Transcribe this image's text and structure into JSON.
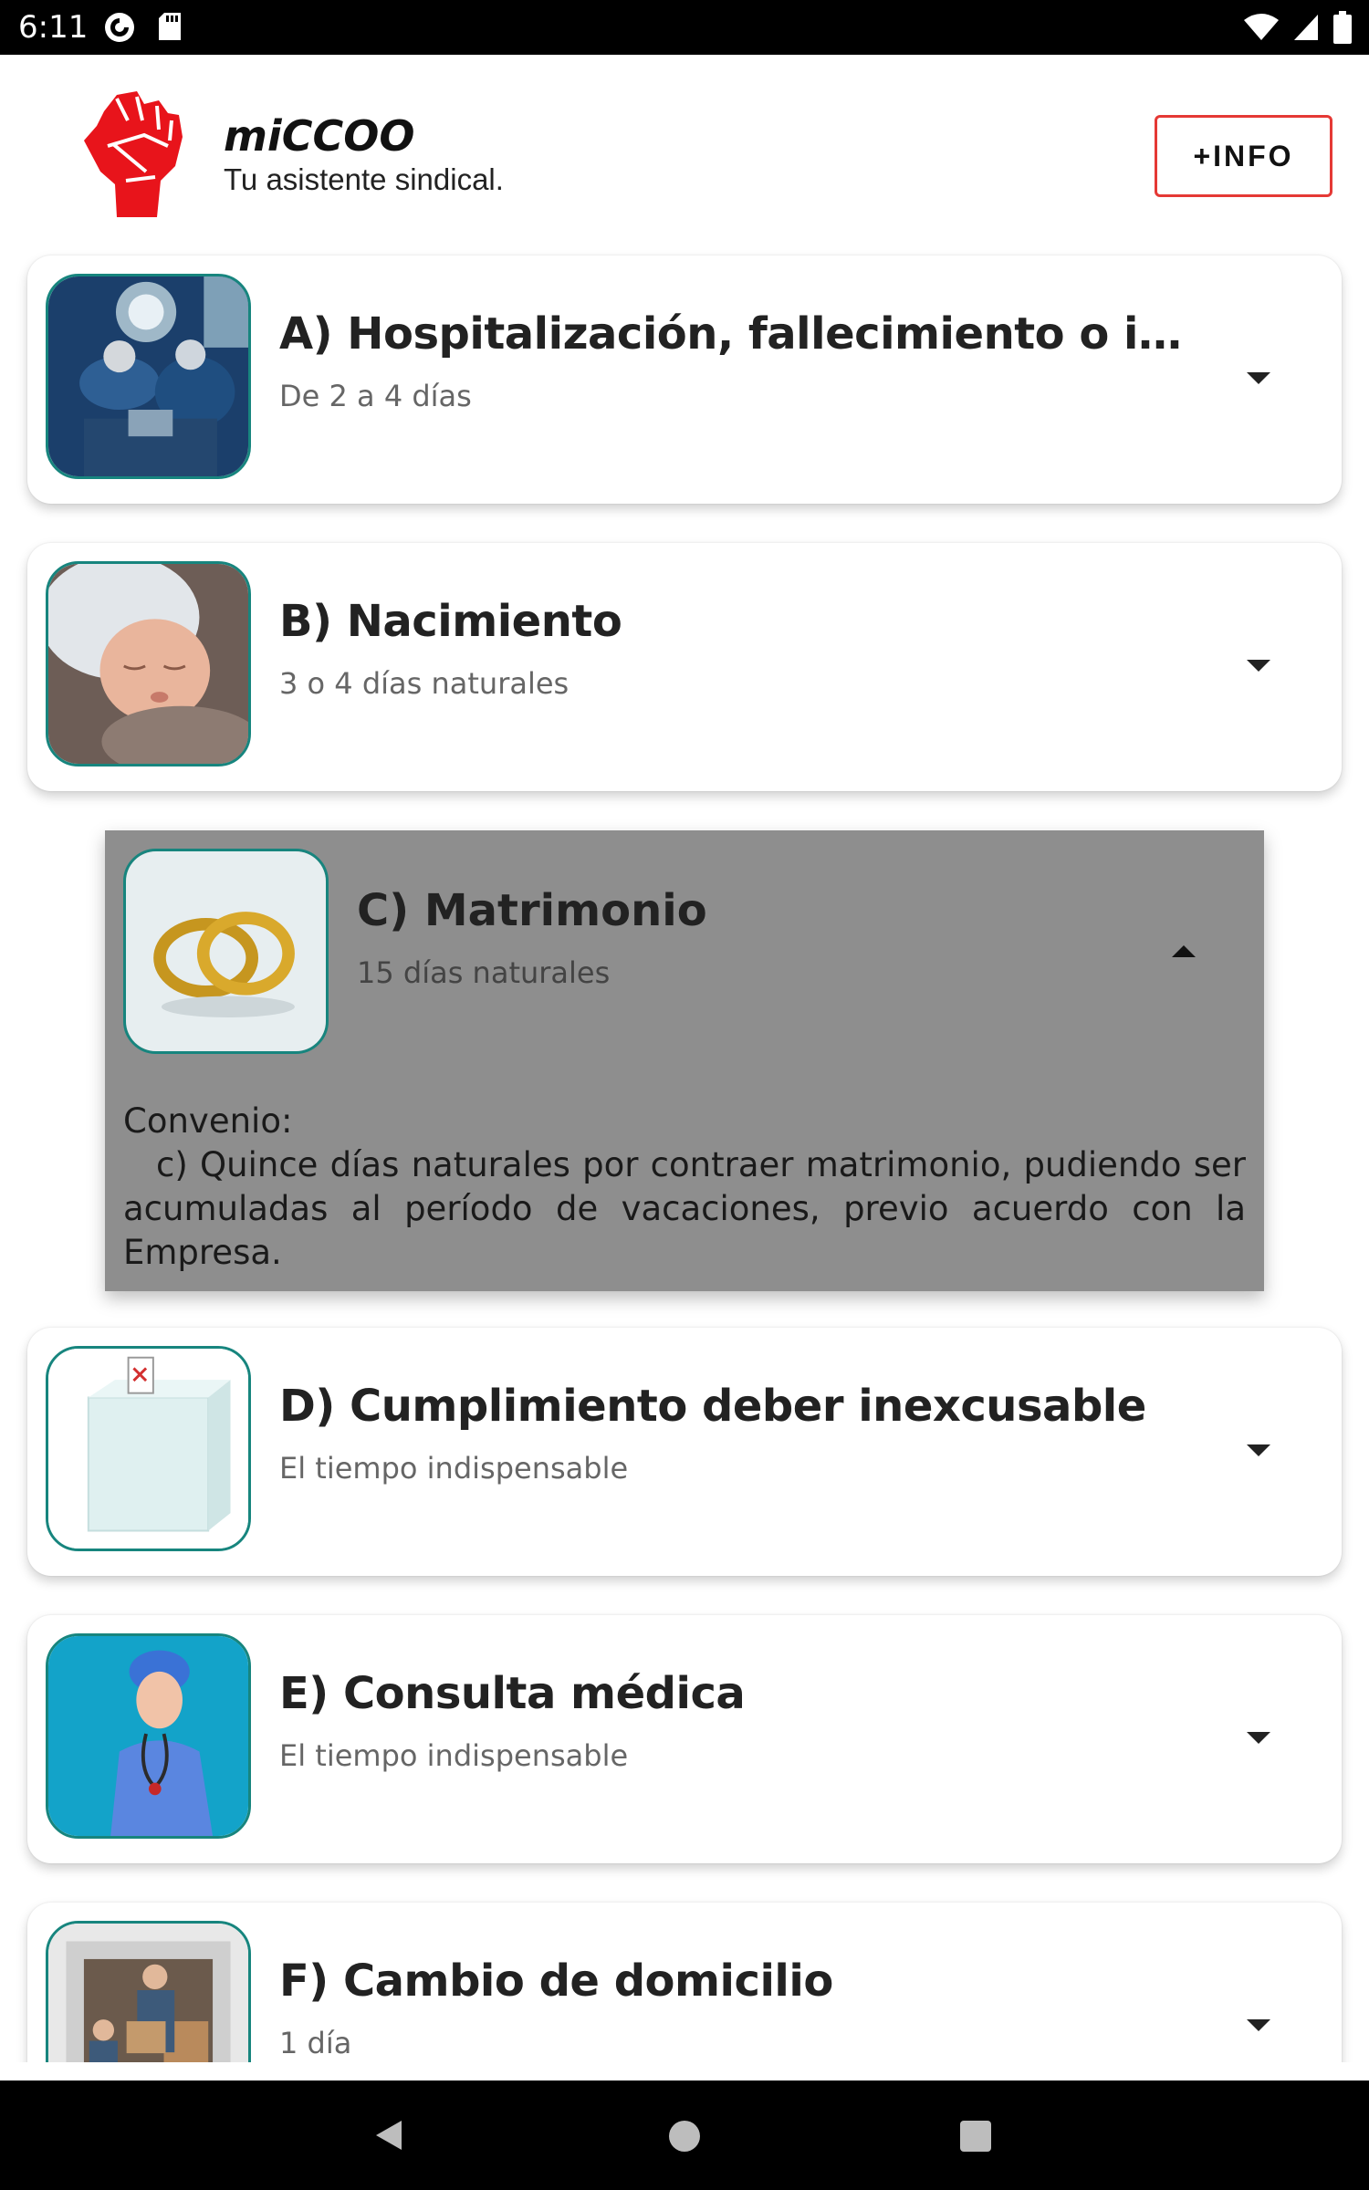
{
  "status_bar": {
    "time": "6:11",
    "icons_left": [
      "pocket-casts-icon",
      "sd-card-icon"
    ],
    "icons_right": [
      "wifi-icon",
      "signal-icon",
      "battery-icon"
    ]
  },
  "header": {
    "logo": "raised-fist-logo",
    "title": "miCCOO",
    "subtitle": "Tu asistente sindical.",
    "info_button": "+INFO",
    "accent_color": "#e53935"
  },
  "permits": [
    {
      "id": "A",
      "title": "A) Hospitalización, fallecimiento o interv...",
      "subtitle": "De 2 a 4 días",
      "image": "surgery-photo",
      "expanded": false
    },
    {
      "id": "B",
      "title": "B) Nacimiento",
      "subtitle": "3 o 4 días naturales",
      "image": "newborn-photo",
      "expanded": false
    },
    {
      "id": "C",
      "title": "C) Matrimonio",
      "subtitle": "15 días naturales",
      "image": "wedding-rings-photo",
      "expanded": true,
      "detail_heading": "Convenio:",
      "detail_body": "c) Quince días naturales por contraer matrimonio, pudiendo ser acumuladas al período de vacaciones, previo acuerdo con la Empresa."
    },
    {
      "id": "D",
      "title": "D) Cumplimiento deber inexcusable",
      "subtitle": "El tiempo indispensable",
      "image": "ballot-box-photo",
      "expanded": false
    },
    {
      "id": "E",
      "title": "E) Consulta médica",
      "subtitle": "El tiempo indispensable",
      "image": "doctor-photo",
      "expanded": false
    },
    {
      "id": "F",
      "title": "F) Cambio de domicilio",
      "subtitle": "1 día",
      "image": "moving-van-photo",
      "expanded": false
    }
  ],
  "nav_bar": {
    "buttons": [
      "back-icon",
      "home-icon",
      "recents-icon"
    ]
  },
  "colors": {
    "thumb_border": "#17857e",
    "expanded_bg": "#8e8e8e",
    "logo_red": "#e8141b"
  }
}
